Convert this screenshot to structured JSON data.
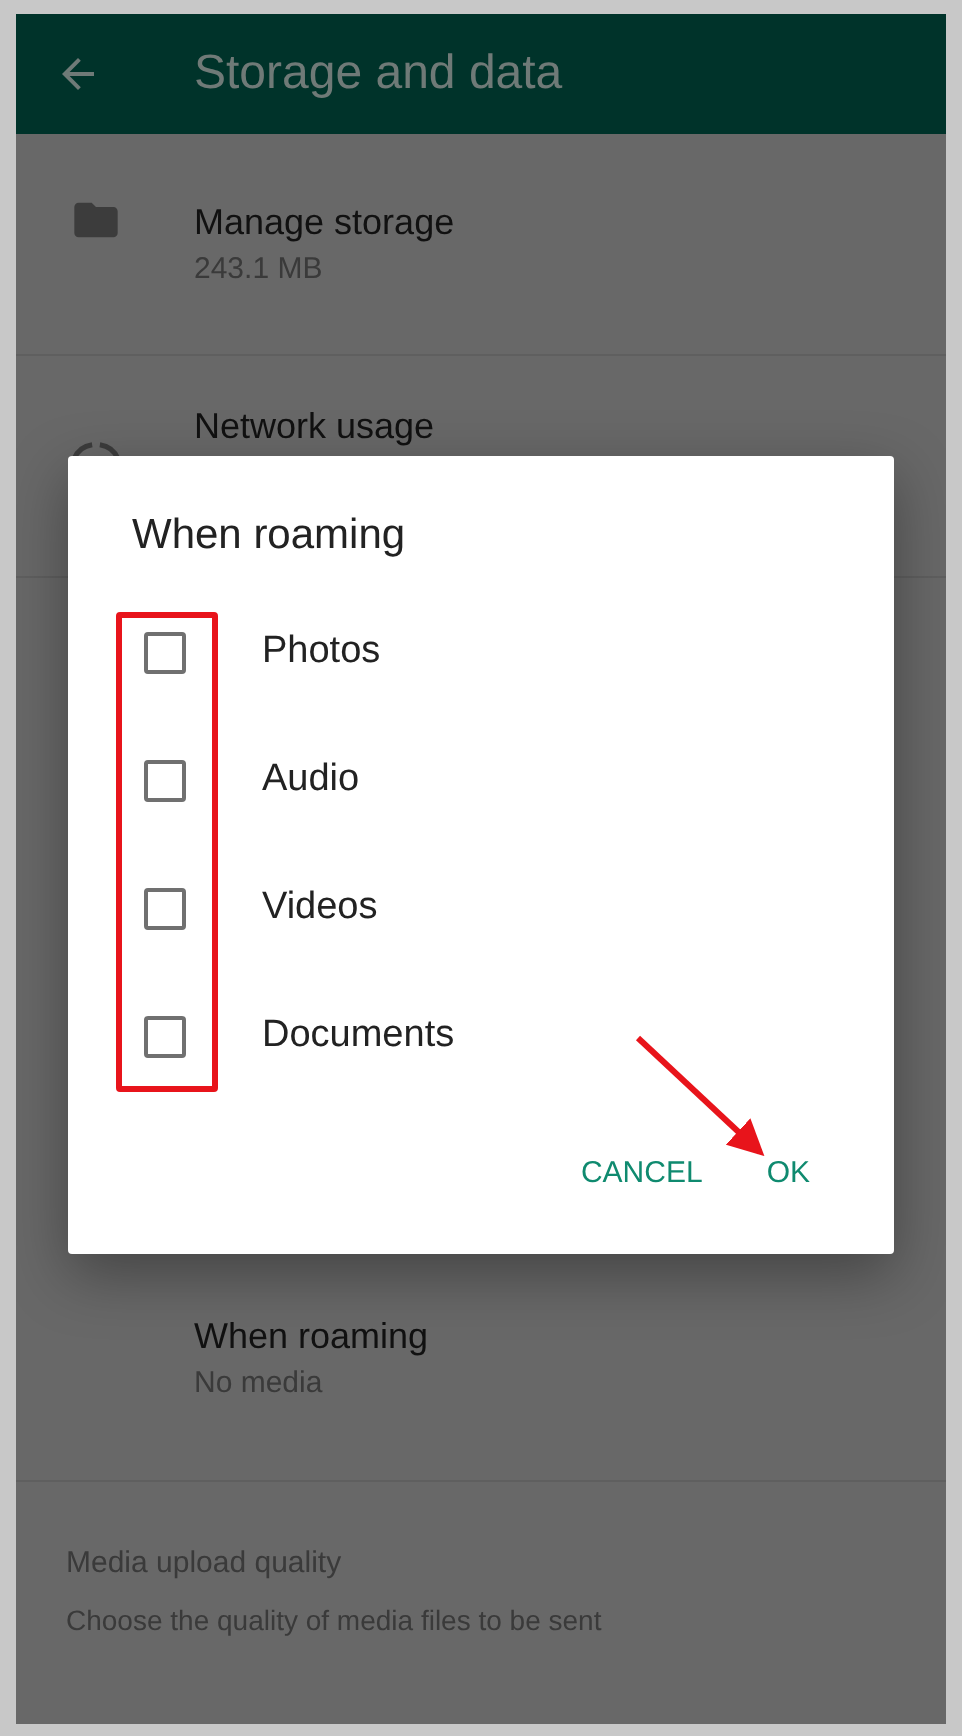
{
  "app_bar": {
    "title": "Storage and data"
  },
  "settings": [
    {
      "kind": "storage",
      "title": "Manage storage",
      "subtitle": "243.1 MB"
    },
    {
      "kind": "network",
      "title": "Network usage"
    }
  ],
  "roaming_row": {
    "title": "When roaming",
    "subtitle": "No media"
  },
  "upload_section": {
    "title": "Media upload quality",
    "subtitle": "Choose the quality of media files to be sent"
  },
  "dialog": {
    "title": "When roaming",
    "options": [
      {
        "label": "Photos",
        "checked": false
      },
      {
        "label": "Audio",
        "checked": false
      },
      {
        "label": "Videos",
        "checked": false
      },
      {
        "label": "Documents",
        "checked": false
      }
    ],
    "buttons": [
      {
        "label": "CANCEL"
      },
      {
        "label": "OK"
      }
    ]
  }
}
